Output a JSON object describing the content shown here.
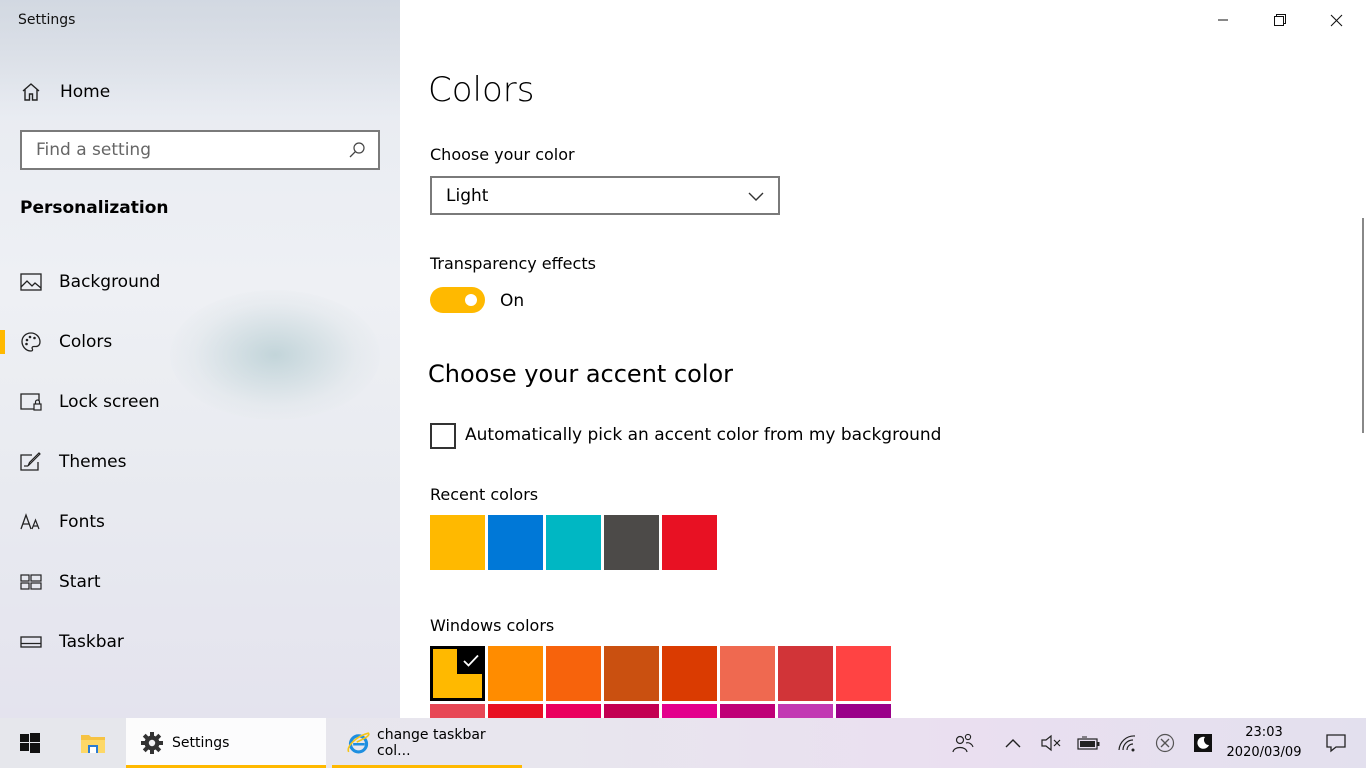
{
  "window": {
    "title": "Settings"
  },
  "sidebar": {
    "home_label": "Home",
    "search_placeholder": "Find a setting",
    "section_title": "Personalization",
    "items": [
      {
        "label": "Background",
        "icon": "picture-icon",
        "active": false
      },
      {
        "label": "Colors",
        "icon": "palette-icon",
        "active": true
      },
      {
        "label": "Lock screen",
        "icon": "lock-screen-icon",
        "active": false
      },
      {
        "label": "Themes",
        "icon": "themes-icon",
        "active": false
      },
      {
        "label": "Fonts",
        "icon": "fonts-icon",
        "active": false
      },
      {
        "label": "Start",
        "icon": "start-icon",
        "active": false
      },
      {
        "label": "Taskbar",
        "icon": "taskbar-icon",
        "active": false
      }
    ]
  },
  "main": {
    "title": "Colors",
    "choose_color_label": "Choose your color",
    "choose_color_value": "Light",
    "transparency_label": "Transparency effects",
    "transparency_state": "On",
    "accent_heading": "Choose your accent color",
    "auto_pick_label": "Automatically pick an accent color from my background",
    "recent_colors_label": "Recent colors",
    "recent_colors": [
      "#ffb900",
      "#0078d7",
      "#00b7c3",
      "#4c4a48",
      "#e81123"
    ],
    "windows_colors_label": "Windows colors",
    "windows_colors_row1": [
      "#ffb900",
      "#ff8c00",
      "#f7630c",
      "#ca5010",
      "#da3b01",
      "#ef6950",
      "#d13438",
      "#ff4343"
    ],
    "windows_colors_row2": [
      "#e74856",
      "#e81123",
      "#ea005e",
      "#c30052",
      "#e3008c",
      "#bf0077",
      "#c239b3",
      "#9a0089"
    ],
    "selected_color": "#ffb900"
  },
  "taskbar": {
    "settings_label": "Settings",
    "browser_label": "change taskbar col...",
    "time": "23:03",
    "date": "2020/03/09"
  },
  "accent": "#ffb900"
}
